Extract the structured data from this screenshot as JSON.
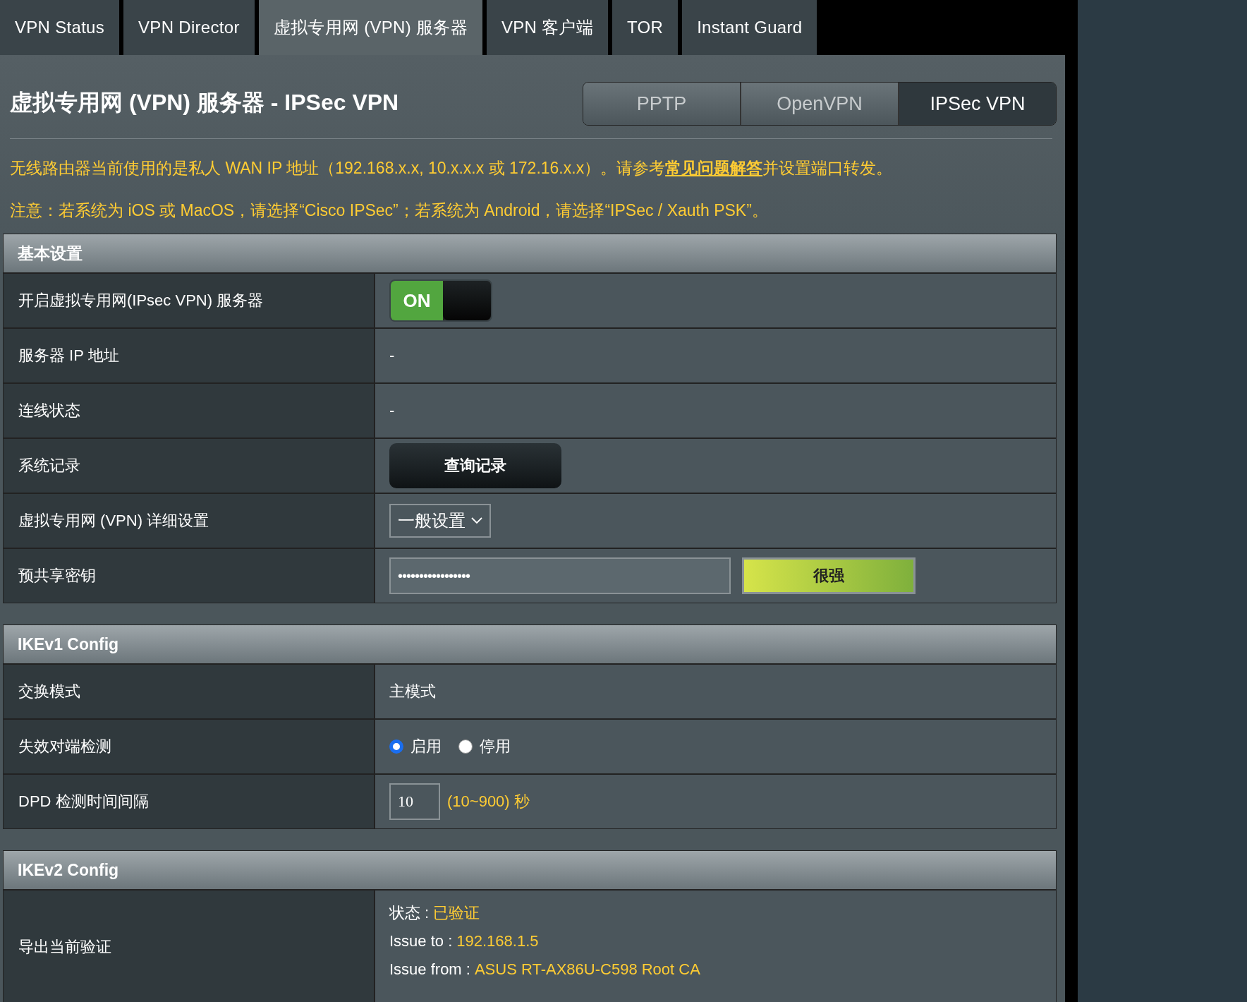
{
  "tabs": [
    {
      "label": "VPN Status",
      "selected": false
    },
    {
      "label": "VPN Director",
      "selected": false
    },
    {
      "label": "虚拟专用网 (VPN) 服务器",
      "selected": true
    },
    {
      "label": "VPN 客户端",
      "selected": false
    },
    {
      "label": "TOR",
      "selected": false
    },
    {
      "label": "Instant Guard",
      "selected": false
    }
  ],
  "page_title": "虚拟专用网 (VPN) 服务器 - IPSec VPN",
  "protocol_tabs": [
    {
      "label": "PPTP",
      "selected": false
    },
    {
      "label": "OpenVPN",
      "selected": false
    },
    {
      "label": "IPSec VPN",
      "selected": true
    }
  ],
  "notices": [
    {
      "before": "无线路由器当前使用的是私人 WAN IP 地址（192.168.x.x, 10.x.x.x 或 172.16.x.x）。请参考",
      "link": "常见问题解答",
      "after": "并设置端口转发。"
    },
    {
      "before": "注意：若系统为 iOS 或 MacOS，请选择“Cisco IPSec”；若系统为 Android，请选择“IPSec / Xauth PSK”。"
    }
  ],
  "sections": [
    {
      "title": "基本设置",
      "rows": [
        {
          "label": "开启虚拟专用网(IPsec VPN) 服务器",
          "kind": "toggle",
          "on": true,
          "text": "ON"
        },
        {
          "label": "服务器 IP 地址",
          "kind": "text",
          "value": "-"
        },
        {
          "label": "连线状态",
          "kind": "text",
          "value": "-"
        },
        {
          "label": "系统记录",
          "kind": "button",
          "button": "查询记录"
        },
        {
          "label": "虚拟专用网 (VPN) 详细设置",
          "kind": "select",
          "value": "一般设置"
        },
        {
          "label": "预共享密钥",
          "kind": "password",
          "value": "•••••••••••••••••",
          "strength": "很强",
          "level": 1
        }
      ]
    },
    {
      "title": "IKEv1 Config",
      "rows": [
        {
          "label": "交换模式",
          "kind": "text",
          "value": "主模式"
        },
        {
          "label": "失效对端检测",
          "kind": "radio",
          "options": [
            {
              "label": "启用",
              "selected": true
            },
            {
              "label": "停用",
              "selected": false
            }
          ]
        },
        {
          "label": "DPD 检测时间间隔",
          "kind": "number",
          "value": "10",
          "hint": "(10~900) 秒"
        }
      ]
    },
    {
      "title": "IKEv2 Config",
      "rows": [
        {
          "label": "导出当前验证",
          "kind": "cert",
          "lines": [
            {
              "label": "状态 :",
              "value": "已验证"
            },
            {
              "label": "Issue to :",
              "value": "192.168.1.5"
            },
            {
              "label": "Issue from :",
              "value": "ASUS RT-AX86U-C598 Root CA"
            }
          ]
        }
      ]
    }
  ]
}
